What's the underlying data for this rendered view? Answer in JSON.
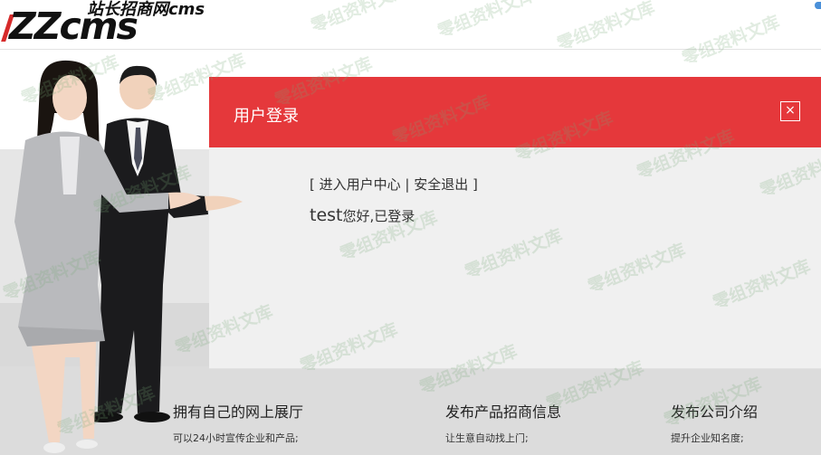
{
  "header": {
    "logo_main": "ZZcms",
    "logo_sub": "站长招商网cms"
  },
  "login": {
    "title": "用户登录",
    "close_label": "×",
    "links_open": "[ ",
    "link_user_center": "进入用户中心",
    "links_sep": " | ",
    "link_logout": "安全退出",
    "links_close": " ]",
    "username": "test",
    "greeting": "您好,已登录"
  },
  "features": [
    {
      "title": "拥有自己的网上展厅",
      "desc": "可以24小时宣传企业和产品;"
    },
    {
      "title": "发布产品招商信息",
      "desc": "让生意自动找上门;"
    },
    {
      "title": "发布公司介绍",
      "desc": "提升企业知名度;"
    }
  ],
  "watermark": "零组资料文库",
  "colors": {
    "accent": "#e5383b",
    "panel": "#f0f0f0"
  }
}
